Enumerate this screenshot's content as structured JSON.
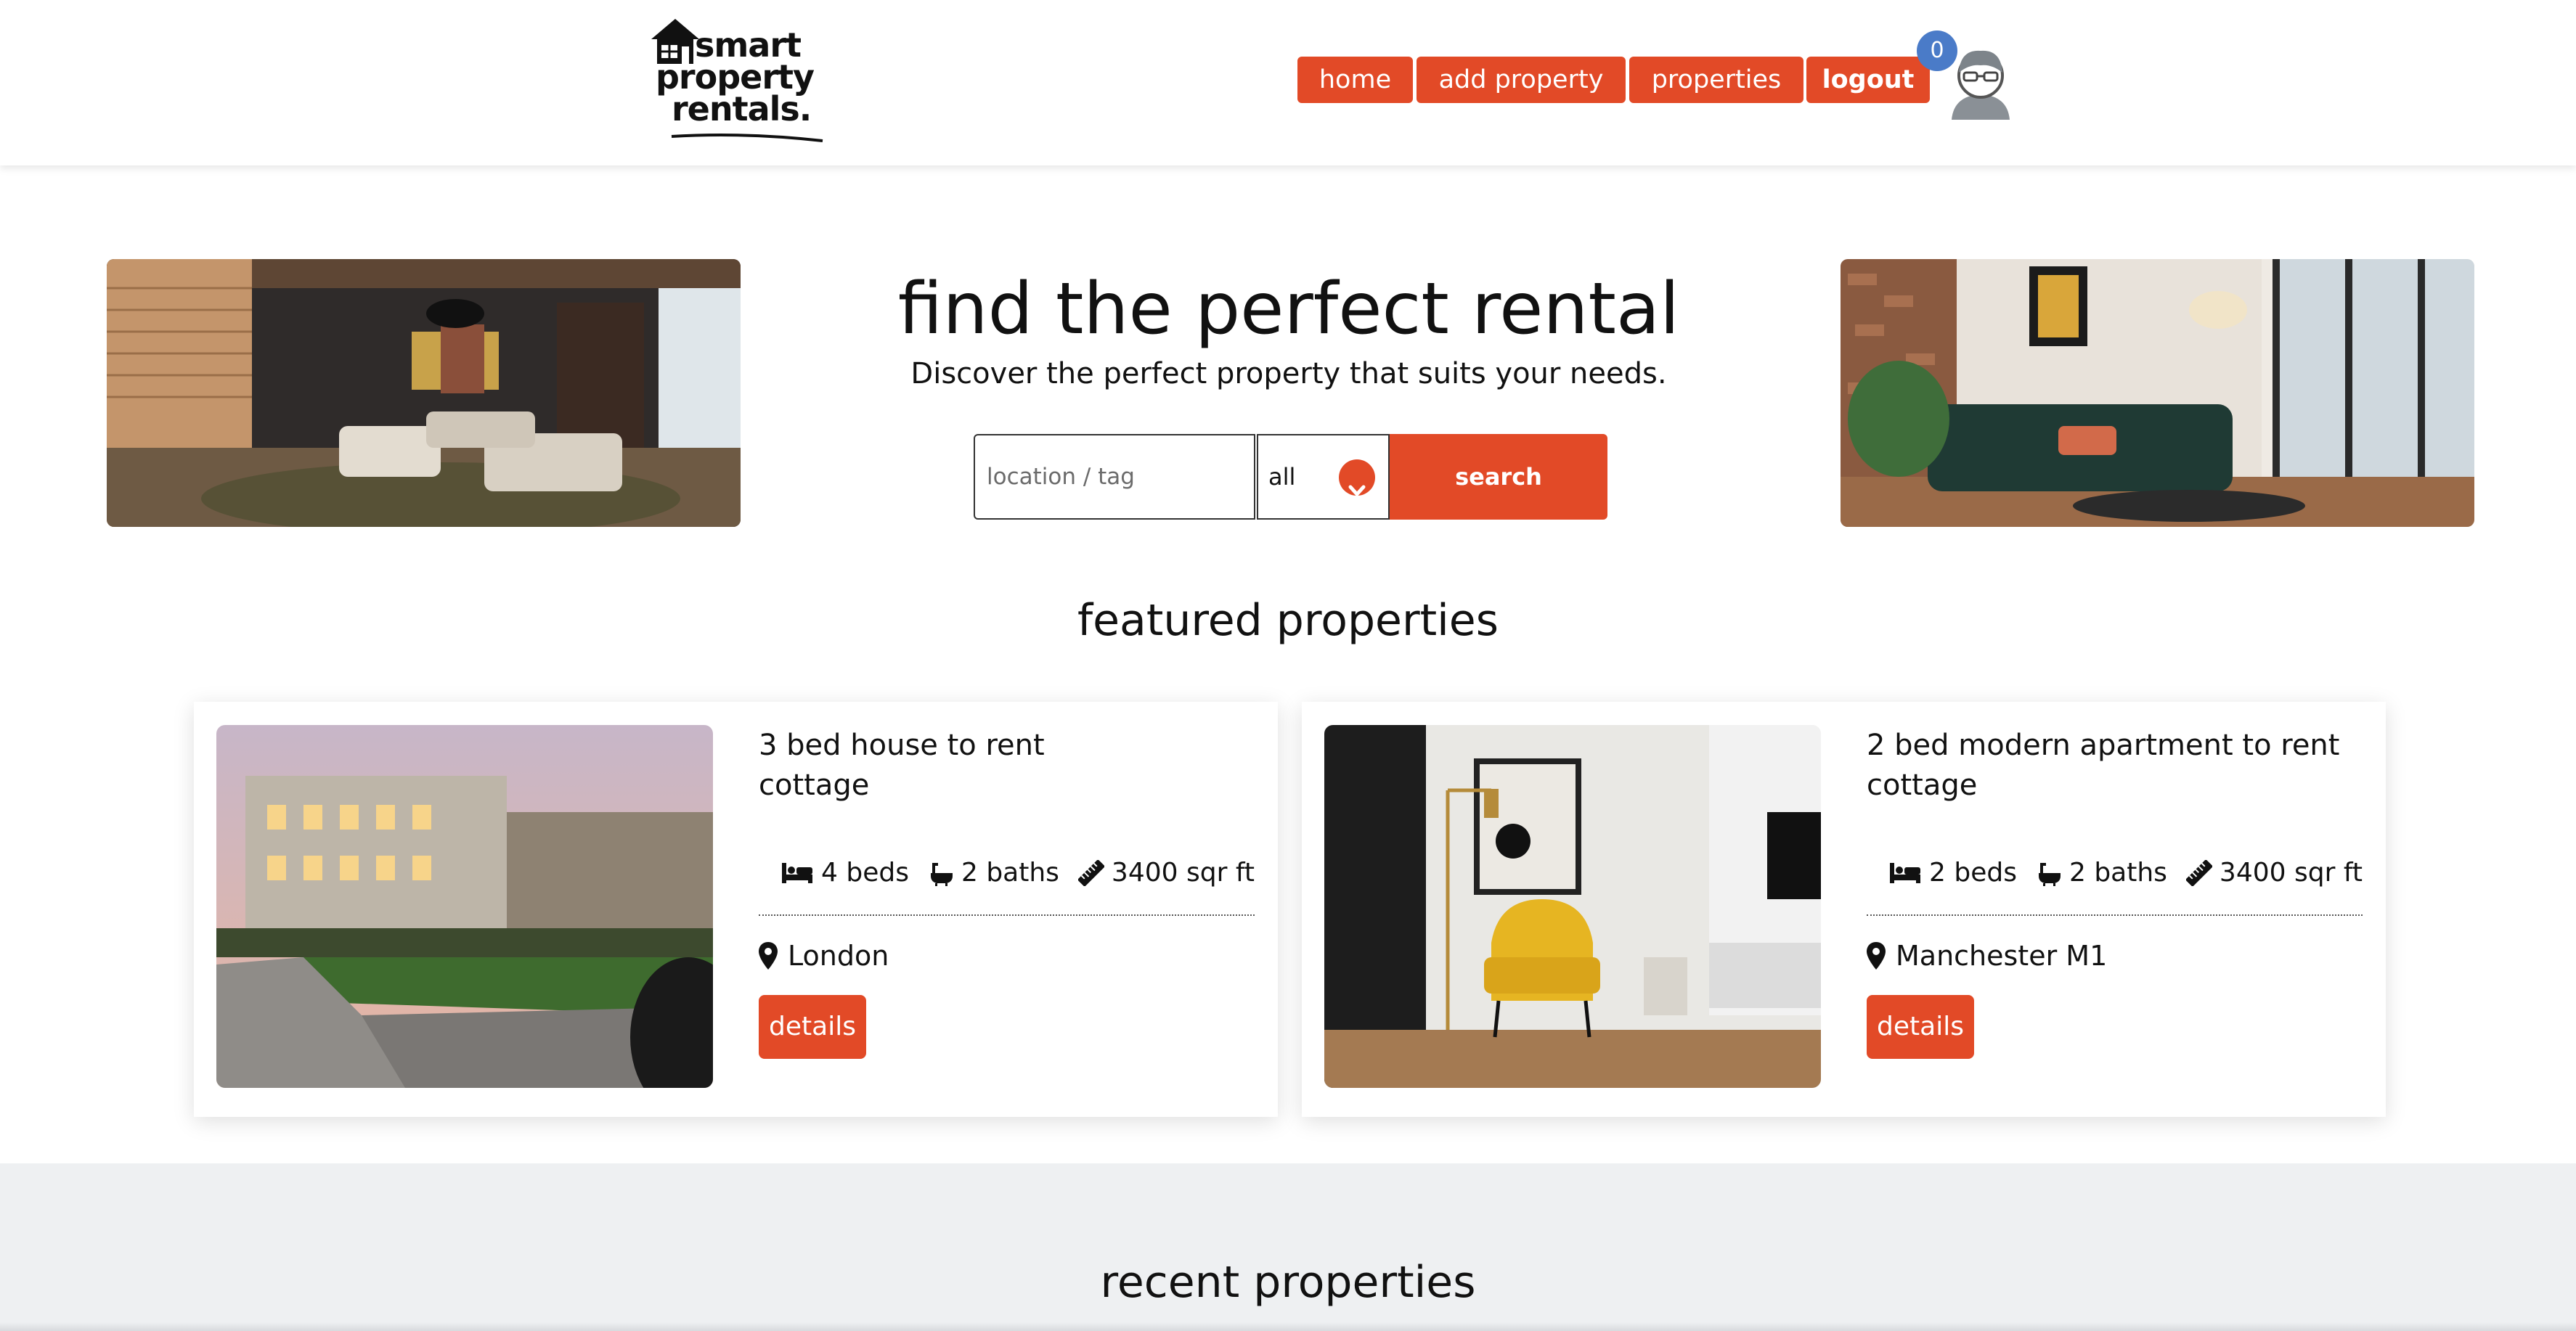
{
  "header": {
    "logo": {
      "line1": "smart",
      "line2": "property",
      "line3": "rentals."
    },
    "nav": [
      {
        "label": "home"
      },
      {
        "label": "add property"
      },
      {
        "label": "properties"
      },
      {
        "label": "logout"
      }
    ],
    "notification_count": "0"
  },
  "hero": {
    "title": "find the perfect rental",
    "subtitle": "Discover the perfect property that suits your needs.",
    "search": {
      "placeholder": "location / tag",
      "select_value": "all",
      "button_label": "search"
    }
  },
  "featured": {
    "title": "featured properties",
    "cards": [
      {
        "title": "3 bed house to rent",
        "type": "cottage",
        "beds": "4 beds",
        "baths": "2 baths",
        "area": "3400 sqr ft",
        "location": "London",
        "button_label": "details"
      },
      {
        "title": "2 bed modern apartment to rent",
        "type": "cottage",
        "beds": "2 beds",
        "baths": "2 baths",
        "area": "3400 sqr ft",
        "location": "Manchester M1",
        "button_label": "details"
      }
    ]
  },
  "recent": {
    "title": "recent properties"
  },
  "colors": {
    "accent": "#e24a27",
    "badge": "#4a7bc8",
    "band": "#eef0f2"
  },
  "icons": [
    "bed-icon",
    "bath-icon",
    "ruler-icon",
    "map-pin-icon",
    "chevron-down-icon",
    "user-avatar-icon",
    "house-logo-icon"
  ]
}
